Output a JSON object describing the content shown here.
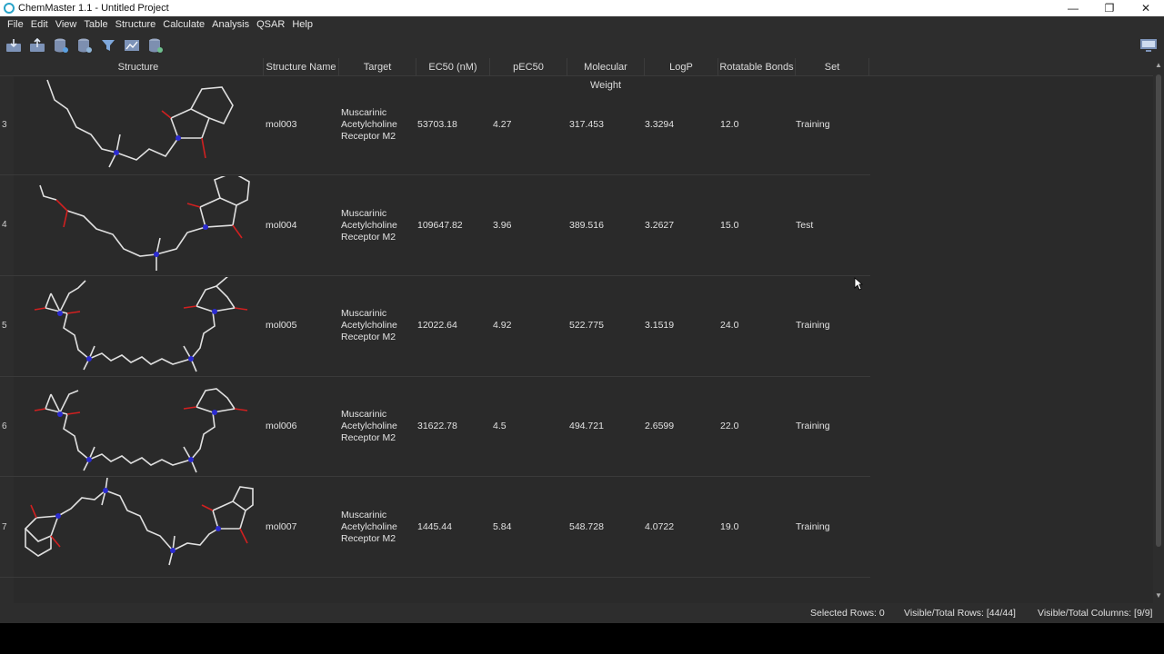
{
  "window": {
    "title": "ChemMaster 1.1 - Untitled Project",
    "minimize": "—",
    "maximize": "❐",
    "close": "✕"
  },
  "menu": [
    "File",
    "Edit",
    "View",
    "Table",
    "Structure",
    "Calculate",
    "Analysis",
    "QSAR",
    "Help"
  ],
  "columns": [
    "Structure",
    "Structure Name",
    "Target",
    "EC50 (nM)",
    "pEC50",
    "Molecular Weight",
    "LogP",
    "Rotatable Bonds",
    "Set"
  ],
  "rows": [
    {
      "num": "3",
      "name": "mol003",
      "target": [
        "Muscarinic",
        "Acetylcholine",
        "Receptor M2"
      ],
      "ec50": "53703.18",
      "pec50": "4.27",
      "mw": "317.453",
      "logp": "3.3294",
      "rot": "12.0",
      "set": "Training"
    },
    {
      "num": "4",
      "name": "mol004",
      "target": [
        "Muscarinic",
        "Acetylcholine",
        "Receptor M2"
      ],
      "ec50": "109647.82",
      "pec50": "3.96",
      "mw": "389.516",
      "logp": "3.2627",
      "rot": "15.0",
      "set": "Test"
    },
    {
      "num": "5",
      "name": "mol005",
      "target": [
        "Muscarinic",
        "Acetylcholine",
        "Receptor M2"
      ],
      "ec50": "12022.64",
      "pec50": "4.92",
      "mw": "522.775",
      "logp": "3.1519",
      "rot": "24.0",
      "set": "Training"
    },
    {
      "num": "6",
      "name": "mol006",
      "target": [
        "Muscarinic",
        "Acetylcholine",
        "Receptor M2"
      ],
      "ec50": "31622.78",
      "pec50": "4.5",
      "mw": "494.721",
      "logp": "2.6599",
      "rot": "22.0",
      "set": "Training"
    },
    {
      "num": "7",
      "name": "mol007",
      "target": [
        "Muscarinic",
        "Acetylcholine",
        "Receptor M2"
      ],
      "ec50": "1445.44",
      "pec50": "5.84",
      "mw": "548.728",
      "logp": "4.0722",
      "rot": "19.0",
      "set": "Training"
    }
  ],
  "status": {
    "selected": "Selected Rows: 0",
    "visible_rows": "Visible/Total Rows: [44/44]",
    "visible_cols": "Visible/Total Columns: [9/9]"
  },
  "colors": {
    "nitrogen": "#2b2bd0",
    "oxygen": "#d02020",
    "bond": "#e0e0e0"
  }
}
